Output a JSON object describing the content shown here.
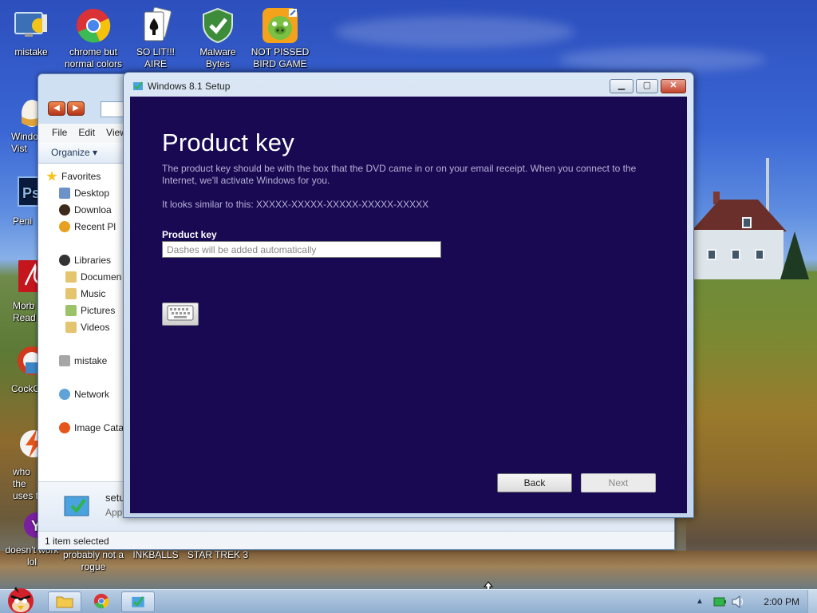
{
  "desktop": {
    "icons": [
      {
        "label": "mistake",
        "icon": "monitor-app-icon"
      },
      {
        "label": "chrome but normal colors",
        "icon": "chrome-icon"
      },
      {
        "label": "SO LIT!!! AIRE",
        "icon": "solitaire-cards-icon"
      },
      {
        "label": "Malware Bytes",
        "icon": "shield-check-icon"
      },
      {
        "label": "NOT PISSED BIRD GAME",
        "icon": "green-pig-icon"
      },
      {
        "label": "Windo Vist",
        "icon": "egg-icon"
      },
      {
        "label": "Peni",
        "icon": "photoshop-icon"
      },
      {
        "label": "Morb Read",
        "icon": "pdf-reader-icon"
      },
      {
        "label": "CockCle",
        "icon": "cleaner-icon"
      },
      {
        "label": "who the uses t",
        "icon": "lightning-icon"
      },
      {
        "label": "doesn't work lol",
        "icon": "yahoo-icon"
      },
      {
        "label": "probably not a rogue",
        "icon": "generic-icon"
      },
      {
        "label": "INKBALLS",
        "icon": "generic-icon"
      },
      {
        "label": "STAR TREK 3",
        "icon": "generic-icon"
      }
    ]
  },
  "explorer": {
    "menu": [
      "File",
      "Edit",
      "View"
    ],
    "organize_label": "Organize ▾",
    "nav": {
      "favorites": "Favorites",
      "desktop": "Desktop",
      "downloads": "Downloa",
      "recent": "Recent Pl",
      "libraries": "Libraries",
      "documents": "Documen",
      "music": "Music",
      "pictures": "Pictures",
      "videos": "Videos",
      "mistake": "mistake",
      "network": "Network",
      "image_catalog": "Image Cata"
    },
    "details": {
      "name": "setu",
      "type": "App"
    },
    "status": "1 item selected"
  },
  "setup": {
    "window_title": "Windows 8.1 Setup",
    "heading": "Product key",
    "description": "The product key should be with the box that the DVD came in or on your email receipt. When you connect to the Internet, we'll activate Windows for you.",
    "similar_text": "It looks similar to this: XXXXX-XXXXX-XXXXX-XXXXX-XXXXX",
    "field_label": "Product key",
    "input_value": "",
    "input_placeholder": "Dashes will be added automatically",
    "back_label": "Back",
    "next_label": "Next",
    "colors": {
      "background": "#190952",
      "text_muted": "#b6b0d6"
    }
  },
  "taskbar": {
    "clock": "2:00 PM"
  }
}
